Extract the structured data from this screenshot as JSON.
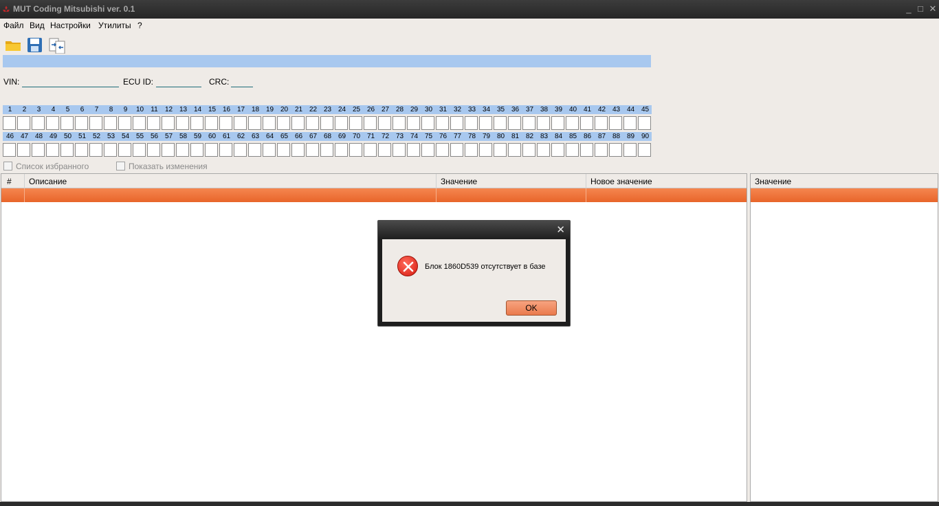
{
  "window": {
    "title": "MUT Coding Mitsubishi  ver. 0.1",
    "minimize": "_",
    "maximize": "□",
    "close": "✕"
  },
  "menu": [
    "Файл",
    "Вид",
    "Настройки",
    "Утилиты",
    "?"
  ],
  "fields": {
    "vin_label": "VIN:",
    "ecu_label": "ECU ID:",
    "crc_label": "CRC:"
  },
  "byte_rows": [
    [
      "1",
      "2",
      "3",
      "4",
      "5",
      "6",
      "7",
      "8",
      "9",
      "10",
      "11",
      "12",
      "13",
      "14",
      "15",
      "16",
      "17",
      "18",
      "19",
      "20",
      "21",
      "22",
      "23",
      "24",
      "25",
      "26",
      "27",
      "28",
      "29",
      "30",
      "31",
      "32",
      "33",
      "34",
      "35",
      "36",
      "37",
      "38",
      "39",
      "40",
      "41",
      "42",
      "43",
      "44",
      "45"
    ],
    [
      "46",
      "47",
      "48",
      "49",
      "50",
      "51",
      "52",
      "53",
      "54",
      "55",
      "56",
      "57",
      "58",
      "59",
      "60",
      "61",
      "62",
      "63",
      "64",
      "65",
      "66",
      "67",
      "68",
      "69",
      "70",
      "71",
      "72",
      "73",
      "74",
      "75",
      "76",
      "77",
      "78",
      "79",
      "80",
      "81",
      "82",
      "83",
      "84",
      "85",
      "86",
      "87",
      "88",
      "89",
      "90"
    ]
  ],
  "checkboxes": {
    "favorites": "Список избранного",
    "show_changes": "Показать изменения"
  },
  "main_table": {
    "headers": [
      "#",
      "Описание",
      "Значение",
      "Новое значение"
    ]
  },
  "side_table": {
    "headers": [
      "Значение"
    ]
  },
  "dialog": {
    "close": "✕",
    "message": "Блок 1860D539 отсутствует в базе",
    "ok": "OK"
  },
  "colors": {
    "selection": "#e8652a",
    "progress": "#a8c8ef",
    "error": "#d61a10"
  }
}
